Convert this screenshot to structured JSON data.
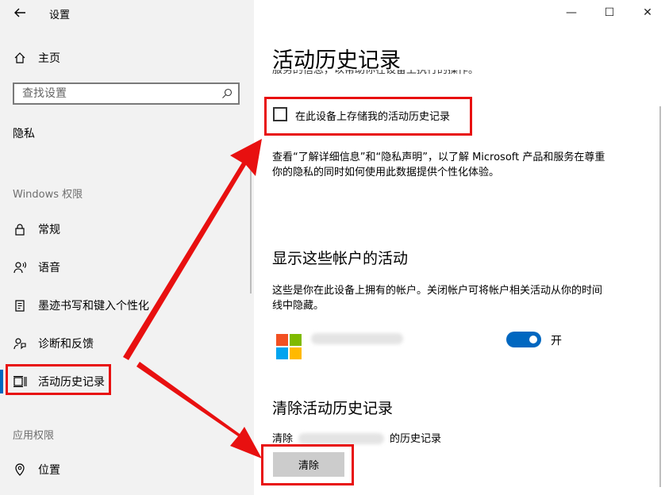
{
  "window": {
    "title": "设置",
    "controls": {
      "minimize": "—",
      "maximize": "☐",
      "close": "✕"
    }
  },
  "sidebar": {
    "home": "主页",
    "search_placeholder": "查找设置",
    "section": "隐私",
    "windows_group": "Windows 权限",
    "items": [
      {
        "label": "常规",
        "icon": "lock-icon"
      },
      {
        "label": "语音",
        "icon": "voice-icon"
      },
      {
        "label": "墨迹书写和键入个性化",
        "icon": "ink-icon"
      },
      {
        "label": "诊断和反馈",
        "icon": "feedback-icon"
      },
      {
        "label": "活动历史记录",
        "icon": "activity-history-icon",
        "selected": true
      }
    ],
    "app_group": "应用权限",
    "app_items": [
      {
        "label": "位置",
        "icon": "location-icon"
      }
    ]
  },
  "main": {
    "title": "活动历史记录",
    "cut_text": "服务的信息，以帮助你在设备上执行的操作。",
    "store_checkbox": {
      "label": "在此设备上存储我的活动历史记录",
      "checked": false
    },
    "privacy_text_1": "查看“了解详细信息”和“隐私声明”，以了解 Microsoft 产品和服务在尊重",
    "privacy_text_2": "你的隐私的同时如何使用此数据提供个性化体验。",
    "accounts_heading": "显示这些帐户的活动",
    "accounts_text_1": "这些是你在此设备上拥有的帐户。关闭帐户可将帐户相关活动从你的时间",
    "accounts_text_2": "线中隐藏。",
    "account_toggle": {
      "state_label": "开",
      "on": true
    },
    "clear_heading": "清除活动历史记录",
    "clear_prefix": "清除",
    "clear_suffix": "的历史记录",
    "clear_button": "清除"
  },
  "colors": {
    "accent": "#0067c0",
    "highlight": "#e81010",
    "ms_red": "#f25022",
    "ms_green": "#7fba00",
    "ms_blue": "#00a4ef",
    "ms_yellow": "#ffb900"
  }
}
